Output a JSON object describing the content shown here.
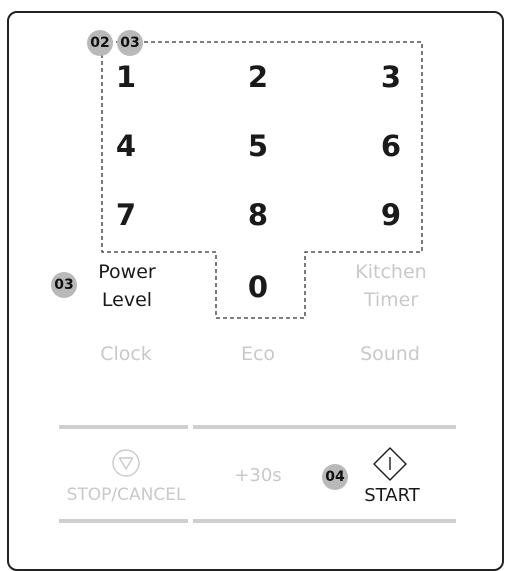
{
  "badges": {
    "keypad_a": "02",
    "keypad_b": "03",
    "power_level": "03",
    "start": "04"
  },
  "keypad": {
    "k1": "1",
    "k2": "2",
    "k3": "3",
    "k4": "4",
    "k5": "5",
    "k6": "6",
    "k7": "7",
    "k8": "8",
    "k9": "9",
    "k0": "0"
  },
  "functions": {
    "power_level_line1": "Power",
    "power_level_line2": "Level",
    "kitchen_timer_line1": "Kitchen",
    "kitchen_timer_line2": "Timer",
    "clock": "Clock",
    "eco": "Eco",
    "sound": "Sound"
  },
  "controls": {
    "stop_cancel": "STOP/CANCEL",
    "plus30": "+30s",
    "start": "START"
  },
  "colors": {
    "active_text": "#1a1a1a",
    "inactive_text": "#c9c9c9",
    "badge_bg": "#b9b9b9"
  }
}
